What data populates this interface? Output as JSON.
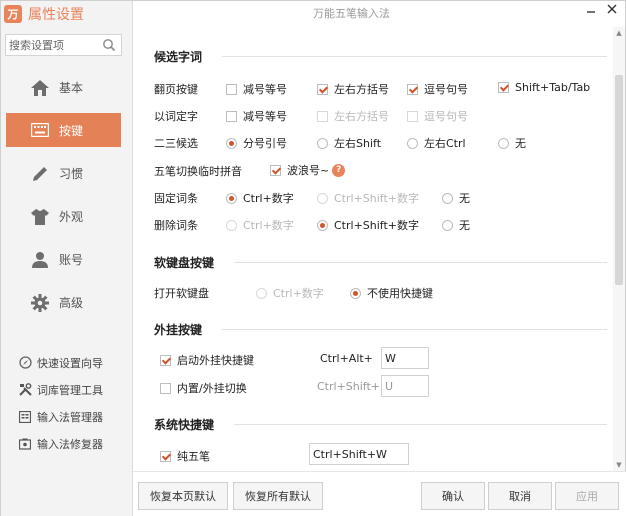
{
  "app": {
    "title": "属性设置",
    "window_title": "万能五笔输入法",
    "logo_glyph": "万",
    "accent_color": "#e58156"
  },
  "search": {
    "placeholder": "搜索设置项"
  },
  "nav": [
    {
      "label": "基本",
      "icon": "home-icon",
      "active": false
    },
    {
      "label": "按键",
      "icon": "keyboard-icon",
      "active": true
    },
    {
      "label": "习惯",
      "icon": "pencil-icon",
      "active": false
    },
    {
      "label": "外观",
      "icon": "shirt-icon",
      "active": false
    },
    {
      "label": "账号",
      "icon": "user-icon",
      "active": false
    },
    {
      "label": "高级",
      "icon": "gear-icon",
      "active": false
    }
  ],
  "tools": [
    {
      "label": "快速设置向导",
      "icon": "wizard-icon"
    },
    {
      "label": "词库管理工具",
      "icon": "tools-icon"
    },
    {
      "label": "输入法管理器",
      "icon": "manager-icon"
    },
    {
      "label": "输入法修复器",
      "icon": "repair-icon"
    }
  ],
  "sections": {
    "candidate": {
      "title": "候选字词",
      "page_keys": {
        "label": "翻页按键",
        "options": [
          "减号等号",
          "左右方括号",
          "逗号句号",
          "Shift+Tab/Tab"
        ]
      },
      "word_select": {
        "label": "以词定字",
        "options": [
          "减号等号",
          "左右方括号",
          "逗号句号"
        ]
      },
      "second_third": {
        "label": "二三候选",
        "options": [
          "分号引号",
          "左右Shift",
          "左右Ctrl",
          "无"
        ]
      },
      "pinyin_switch": {
        "label": "五笔切换临时拼音",
        "option": "波浪号~"
      },
      "fixed_word": {
        "label": "固定词条",
        "options": [
          "Ctrl+数字",
          "Ctrl+Shift+数字",
          "无"
        ]
      },
      "delete_word": {
        "label": "删除词条",
        "options": [
          "Ctrl+数字",
          "Ctrl+Shift+数字",
          "无"
        ]
      }
    },
    "soft_keyboard": {
      "title": "软键盘按键",
      "open": {
        "label": "打开软键盘",
        "options": [
          "Ctrl+数字",
          "不使用快捷键"
        ]
      }
    },
    "plugin": {
      "title": "外挂按键",
      "enable": {
        "label": "启动外挂快捷键",
        "combo": "Ctrl+Alt+",
        "key": "W"
      },
      "switch": {
        "label": "内置/外挂切换",
        "combo": "Ctrl+Shift+",
        "key": "U"
      }
    },
    "system": {
      "title": "系统快捷键",
      "pure": {
        "label": "纯五笔",
        "key": "Ctrl+Shift+W"
      }
    }
  },
  "footer": {
    "restore_page": "恢复本页默认",
    "restore_all": "恢复所有默认",
    "ok": "确认",
    "cancel": "取消",
    "apply": "应用"
  }
}
